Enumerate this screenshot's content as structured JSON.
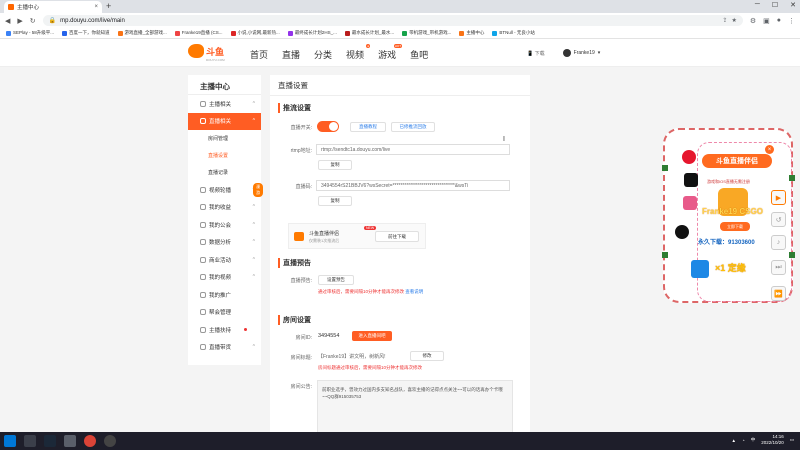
{
  "browser": {
    "tab_title": "主播中心",
    "tab_close": "×",
    "new_tab": "+",
    "url": "mp.douyu.com/live/main",
    "window_minimize": "─",
    "window_maximize": "☐",
    "window_close": "✕",
    "bookmarks": [
      "SEPlay - 58升级平...",
      "百度一下，你就知道",
      "游戏直播_全部游戏...",
      "Franke19直播 (CS...",
      "小说,小说网,最新热...",
      "最终成长计划2HS_...",
      "最水成长计划_最水...",
      "带机游戏_带机游戏...",
      "主播中心",
      "BTNull - 无良小站"
    ]
  },
  "site": {
    "logo_text": "斗鱼",
    "logo_sub": "DOUYU.COM",
    "nav": [
      {
        "label": "首页"
      },
      {
        "label": "直播"
      },
      {
        "label": "分类"
      },
      {
        "label": "视频",
        "badge": "●"
      },
      {
        "label": "游戏",
        "badge": "HOT"
      },
      {
        "label": "鱼吧"
      }
    ],
    "download": "下载",
    "username": "Franke19"
  },
  "sidebar": {
    "title": "主播中心",
    "items": [
      {
        "label": "主播相关",
        "chev": "^"
      },
      {
        "label": "直播相关",
        "chev": "^"
      },
      {
        "label": "房间管理"
      },
      {
        "label": "直播设置"
      },
      {
        "label": "直播记录"
      },
      {
        "label": "视频轮播",
        "chev": "^",
        "tag": "漫游"
      },
      {
        "label": "我的收益",
        "chev": "^"
      },
      {
        "label": "我的公会",
        "chev": "^"
      },
      {
        "label": "数据分析",
        "chev": "^"
      },
      {
        "label": "商业活动",
        "chev": "^"
      },
      {
        "label": "我的视频",
        "chev": "^"
      },
      {
        "label": "我的推广"
      },
      {
        "label": "帮会管理"
      },
      {
        "label": "主播扶持"
      },
      {
        "label": "直播带货",
        "chev": "^"
      }
    ]
  },
  "main": {
    "page_title": "直播设置",
    "section1": "推流设置",
    "switch_label": "直播开关:",
    "btn_settings": "直播教程",
    "btn_record": "已修推流回放",
    "rtmp_label": "rtmp地址:",
    "rtmp_value": "rtmp://sendtc1a.douyu.com/live",
    "copy": "复制",
    "code_label": "直播码:",
    "code_value": "3494554rS21BBJV6?wsSecret=********************************&wsTi",
    "helper_title": "斗鱼直播伴侣",
    "helper_sub": "仅需装1次推流后",
    "helper_new": "NEW",
    "helper_btn": "前往下载",
    "section2": "直播预告",
    "preview_label": "直播预告:",
    "preview_btn": "设置预告",
    "preview_warn": "通过审核后，需要间隔10分钟才能再次修改",
    "preview_link": "查看说明",
    "section3": "房间设置",
    "roomid_label": "房间ID:",
    "roomid_value": "3494554",
    "roomid_btn": "进入直播间吧",
    "roomtitle_label": "房间标题:",
    "roomtitle_value": "【Franke19】讲文明，树新风!",
    "edit": "修改",
    "roomtitle_warn": "房间标题通过审核后，需要间隔10分钟才能再次修改",
    "notice_label": "房间公告:",
    "notice_text": "前职业选手，曾效力过国内多支知名战队，喜欢主播的记得点点关注~~可以的话再办个卡哦~~QQ群915035753"
  },
  "ad": {
    "banner": "斗鱼直播伴侣",
    "sub": "游戏和IOS直播无需注册",
    "name": "Franke19 CSGO",
    "button": "立即下载",
    "download": "永久下载：91303600",
    "speed": "×1 定缘"
  },
  "taskbar": {
    "time": "14:16",
    "date": "2022/10/20",
    "ime": "中"
  }
}
